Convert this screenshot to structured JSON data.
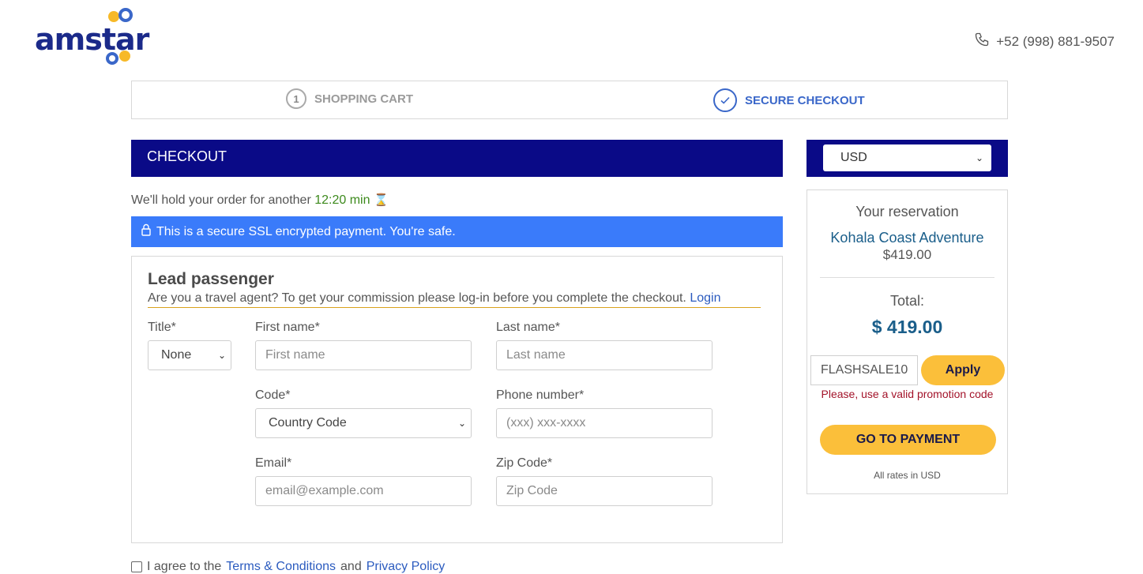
{
  "header": {
    "logo_text": "amstar",
    "phone": "+52 (998) 881-9507",
    "brand_colors": {
      "navy": "#1b2a8a",
      "yellow": "#f7b928",
      "blue": "#3a67c9"
    }
  },
  "steps": [
    {
      "number": "1",
      "label": "SHOPPING CART"
    },
    {
      "label": "SECURE CHECKOUT"
    }
  ],
  "checkout": {
    "title": "CHECKOUT",
    "hold_prefix": "We'll hold your order for another",
    "hold_time": "12:20 min",
    "ssl_message": "This is a secure SSL encrypted payment. You're safe."
  },
  "lead": {
    "title": "Lead passenger",
    "agent_text": "Are you a travel agent? To get your commission please log-in before you complete the checkout.",
    "login_link": "Login",
    "fields": {
      "title_label": "Title*",
      "title_value": "None",
      "first_name_label": "First name*",
      "first_name_placeholder": "First name",
      "last_name_label": "Last name*",
      "last_name_placeholder": "Last name",
      "code_label": "Code*",
      "code_value": "Country Code",
      "phone_label": "Phone number*",
      "phone_placeholder": "(xxx) xxx-xxxx",
      "email_label": "Email*",
      "email_placeholder": "email@example.com",
      "zip_label": "Zip Code*",
      "zip_placeholder": "Zip Code"
    }
  },
  "sidebar": {
    "currency": "USD",
    "reservation_heading": "Your reservation",
    "tour_name": "Kohala Coast Adventure",
    "tour_price": "$419.00",
    "total_label": "Total:",
    "total_value": "$ 419.00",
    "promo_value": "FLASHSALE10",
    "apply_label": "Apply",
    "promo_error": "Please, use a valid promotion code",
    "go_payment_label": "GO TO PAYMENT",
    "rates_note": "All rates in USD"
  },
  "agree": {
    "prefix": "I agree to the",
    "terms_link": "Terms & Conditions",
    "and": "and",
    "privacy_link": "Privacy Policy"
  }
}
